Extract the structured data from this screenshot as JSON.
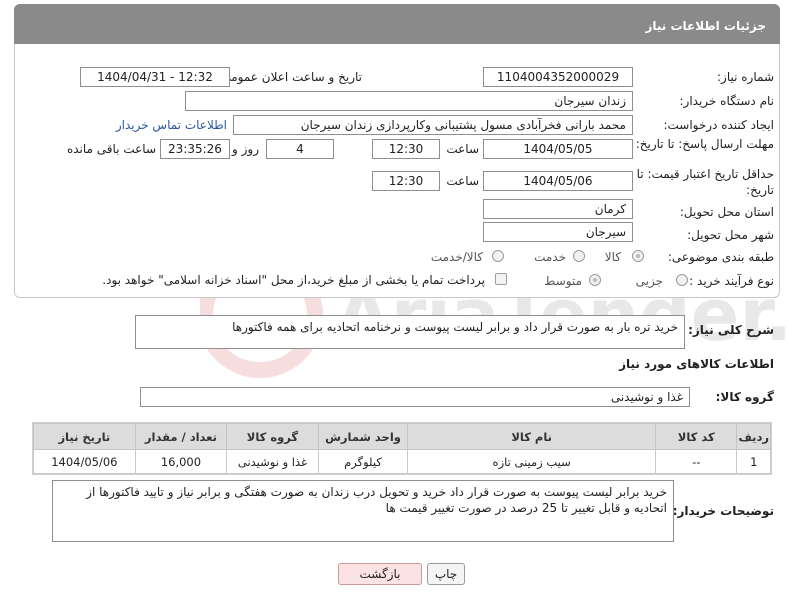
{
  "header": {
    "title": "جزئیات اطلاعات نیاز"
  },
  "form": {
    "need_number_label": "شماره نیاز:",
    "need_number": "1104004352000029",
    "announce_label": "تاریخ و ساعت اعلان عمومی:",
    "announce_value": "1404/04/31 - 12:32",
    "buyer_org_label": "نام دستگاه خریدار:",
    "buyer_org": "زندان سیرجان",
    "creator_label": "ایجاد کننده درخواست:",
    "creator": "محمد بارانی فخرآبادی مسول پشتیبانی وکارپردازی زندان سیرجان",
    "contact_link": "اطلاعات تماس خریدار",
    "deadline_label": "مهلت ارسال پاسخ: تا تاریخ:",
    "deadline_date": "1404/05/05",
    "time_label": "ساعت",
    "deadline_time": "12:30",
    "days_value": "4",
    "days_label": "روز و",
    "remaining_value": "23:35:26",
    "remaining_label": "ساعت باقی مانده",
    "validity_label": "حداقل تاریخ اعتبار قیمت: تا تاریخ:",
    "validity_date": "1404/05/06",
    "validity_time": "12:30",
    "province_label": "استان محل تحویل:",
    "province": "کرمان",
    "city_label": "شهر محل تحویل:",
    "city": "سیرجان",
    "category_label": "طبقه بندی موضوعی:",
    "category_options": [
      "کالا",
      "خدمت",
      "کالا/خدمت"
    ],
    "process_label": "نوع فرآیند خرید :",
    "process_options": [
      "جزیی",
      "متوسط"
    ],
    "payment_note": "پرداخت تمام یا بخشی از مبلغ خرید،از محل \"اسناد خزانه اسلامی\" خواهد بود."
  },
  "description": {
    "label": "شرح کلی نیاز:",
    "text": "خرید تره بار به صورت قرار داد و برابر لیست پیوست و نرخنامه اتحادیه برای همه فاکتورها"
  },
  "goods": {
    "section_title": "اطلاعات کالاهای مورد نیاز",
    "group_label": "گروه کالا:",
    "group_value": "غذا و نوشیدنی",
    "columns": [
      "ردیف",
      "کد کالا",
      "نام کالا",
      "واحد شمارش",
      "گروه کالا",
      "تعداد / مقدار",
      "تاریخ نیاز"
    ],
    "rows": [
      [
        "1",
        "--",
        "سیب زمینی تازه",
        "کیلوگرم",
        "غذا و نوشیدنی",
        "16,000",
        "1404/05/06"
      ]
    ]
  },
  "buyer_notes": {
    "label": "توضیحات خریدار:",
    "text": "خرید برابر لیست پیوست به صورت قرار داد خرید و تحویل درب زندان به صورت هفتگی و برابر نیاز و تایید فاکتورها از اتحادیه و قابل تغییر تا 25 درصد در صورت تغییر قیمت ها"
  },
  "buttons": {
    "print": "چاپ",
    "back": "بازگشت"
  },
  "watermark": {
    "text": "AriaTender.net"
  },
  "colors": {
    "header": "#8a8a8a",
    "link": "#2a57a8",
    "back_button": "#fbe3e3",
    "watermark": "#d23b3b"
  }
}
